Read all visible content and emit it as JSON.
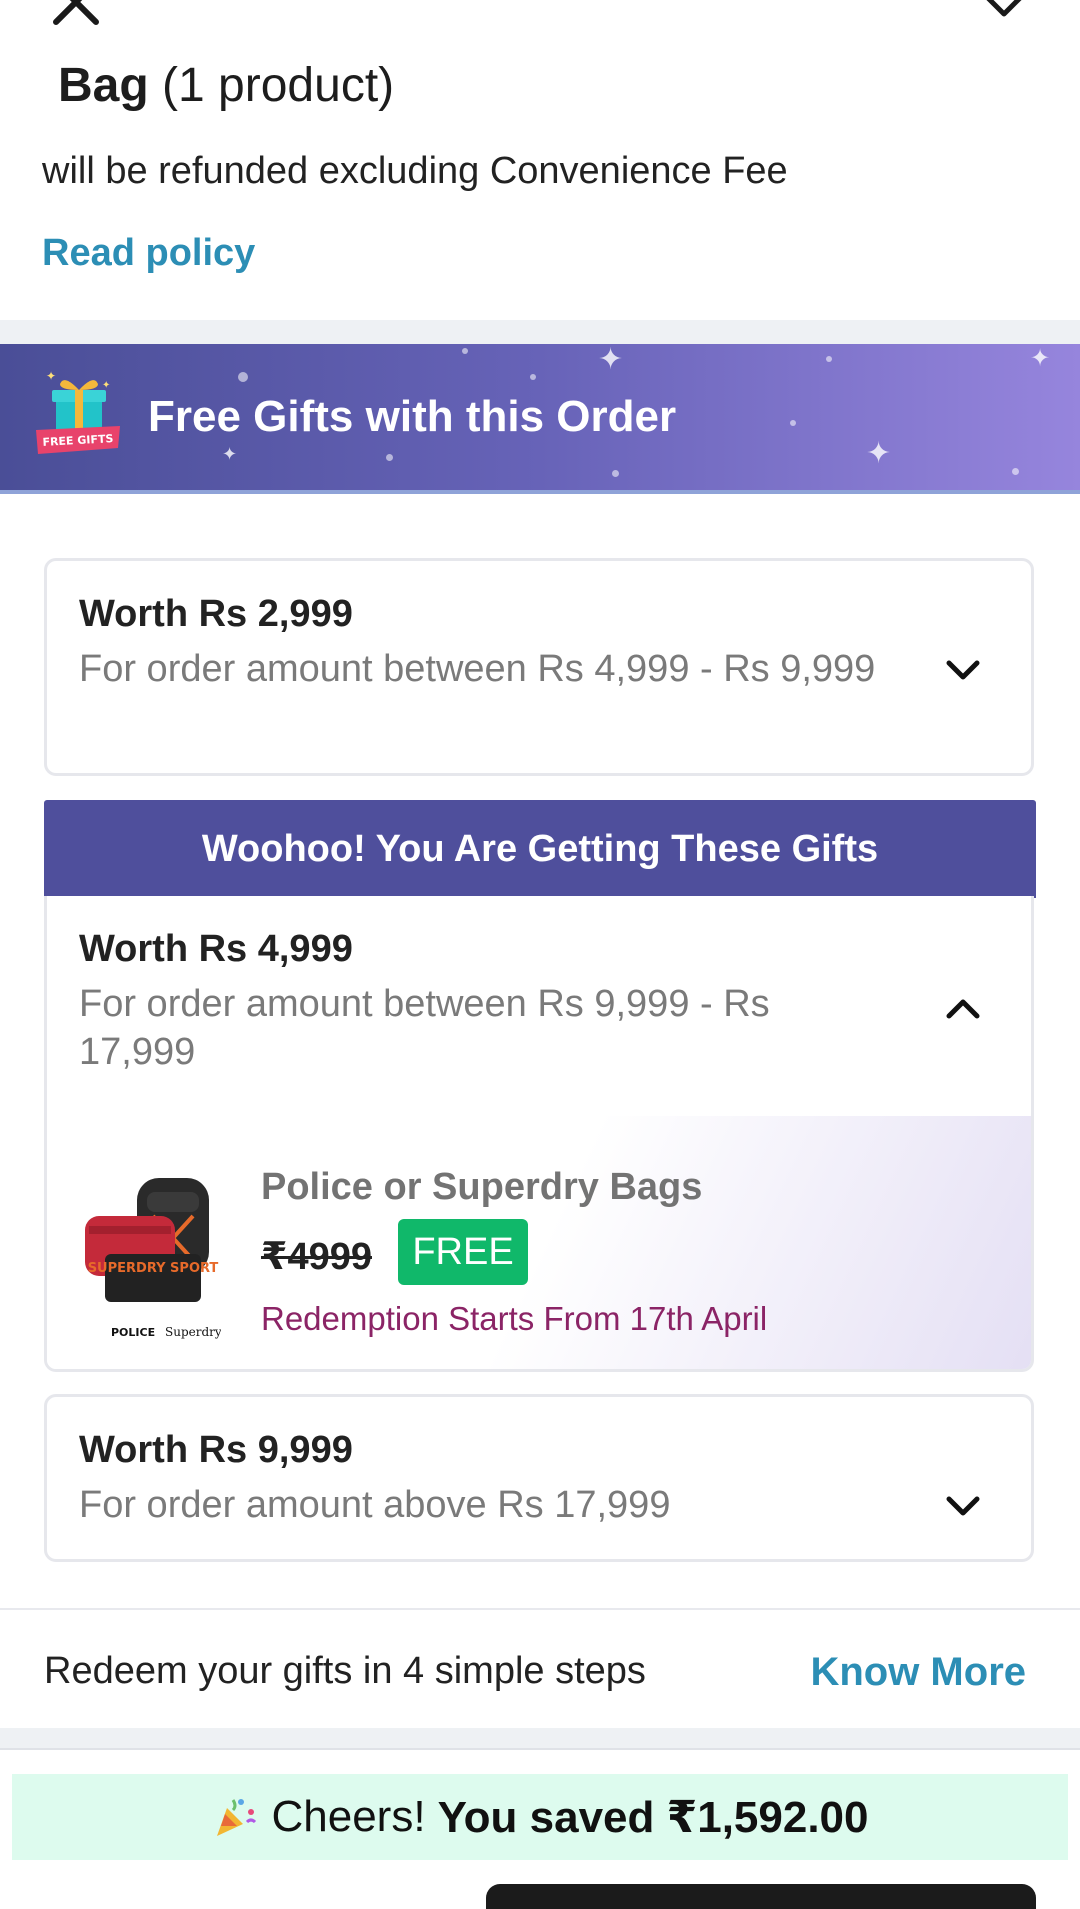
{
  "header": {
    "bag_label": "Bag",
    "product_count": "(1 product)"
  },
  "refund": {
    "text": "will be refunded excluding Convenience Fee",
    "read_policy": "Read policy"
  },
  "gifts_banner": {
    "badge_text": "FREE GIFTS",
    "title": "Free Gifts with this Order"
  },
  "gift_tiers": [
    {
      "worth": "Worth Rs 2,999",
      "range": "For order amount between Rs 4,999 - Rs 9,999",
      "state": "collapsed"
    },
    {
      "banner": "Woohoo! You Are Getting These Gifts",
      "worth": "Worth Rs 4,999",
      "range": "For order amount between Rs 9,999 - Rs 17,999",
      "state": "expanded",
      "item": {
        "name": "Police or Superdry Bags",
        "old_price": "₹4999",
        "badge": "FREE",
        "note": "Redemption Starts From 17th April",
        "brand_left": "POLICE",
        "brand_right": "Superdry",
        "bag_text": "SUPERDRY SPORT"
      }
    },
    {
      "worth": "Worth Rs 9,999",
      "range": "For order amount above Rs 17,999",
      "state": "collapsed"
    }
  ],
  "redeem": {
    "text": "Redeem your gifts in 4 simple steps",
    "link": "Know More"
  },
  "savings": {
    "prefix": "Cheers!",
    "text": "You saved ₹1,592.00"
  },
  "colors": {
    "link": "#2c8eb5",
    "banner_start": "#4a4e97",
    "banner_end": "#9685dd",
    "woohoo_bg": "#4f4f9c",
    "free_badge": "#10b86a",
    "redemption_text": "#8b2466",
    "savings_bg": "#ddfbee"
  }
}
